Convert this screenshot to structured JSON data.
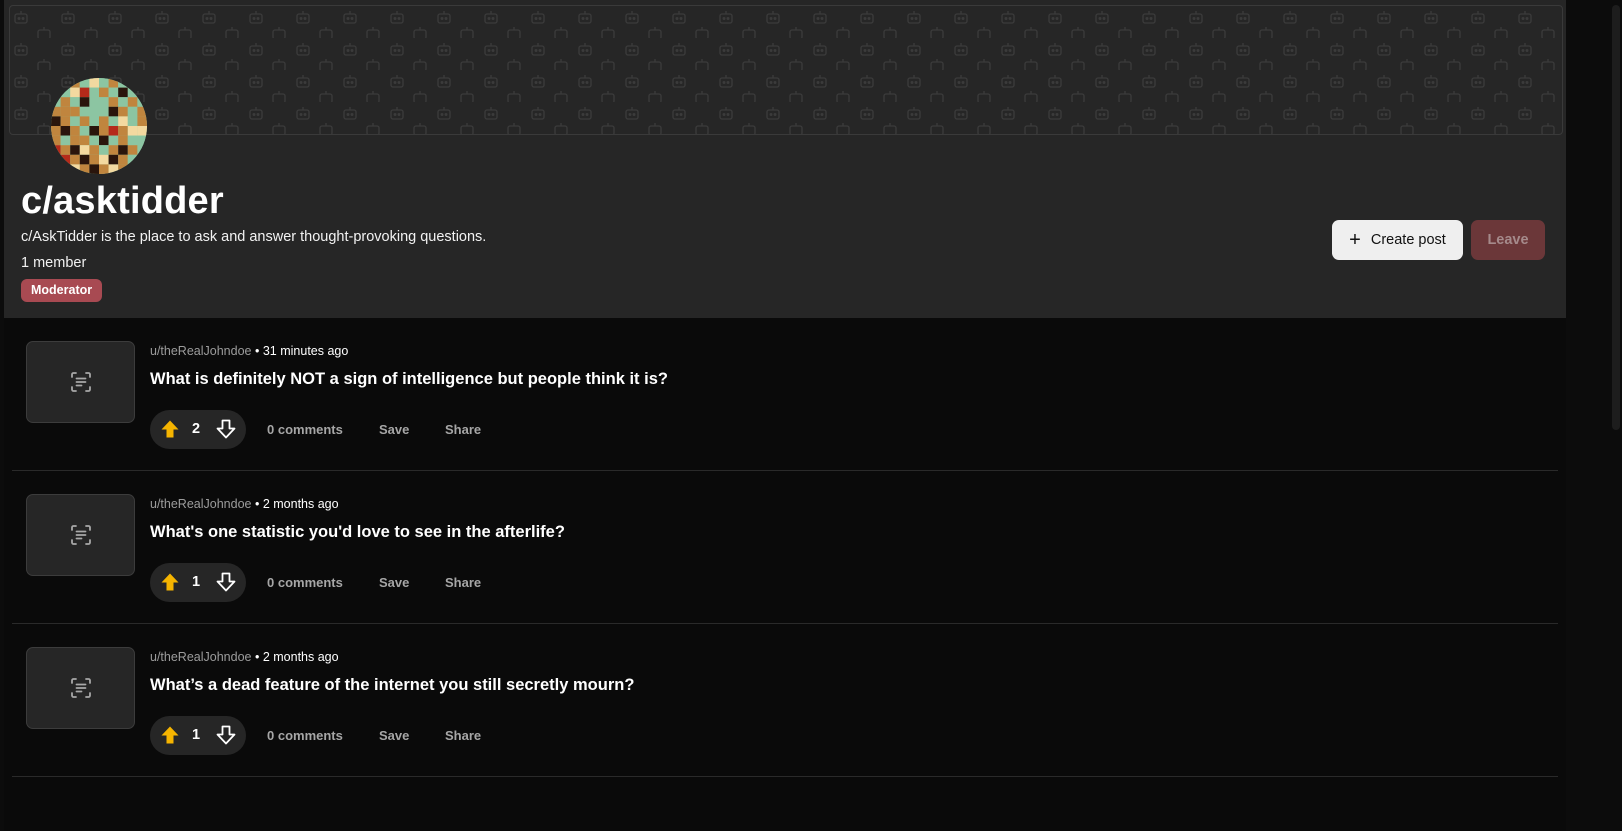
{
  "community": {
    "name": "c/asktidder",
    "description": "c/AskTidder is the place to ask and answer thought-provoking questions.",
    "members": "1 member",
    "role_badge": "Moderator"
  },
  "actions": {
    "create_post": "Create post",
    "leave": "Leave"
  },
  "colors": {
    "header_bg": "#262626",
    "feed_bg": "#0a0a0a",
    "badge": "#a84a52",
    "upvote": "#f5b400",
    "leave_button": "#6b3739"
  },
  "posts": [
    {
      "author": "u/theRealJohndoe",
      "time": "31 minutes ago",
      "title": "What is definitely NOT a sign of intelligence but people think it is?",
      "score": "2",
      "comments": "0 comments",
      "save": "Save",
      "share": "Share"
    },
    {
      "author": "u/theRealJohndoe",
      "time": "2 months ago",
      "title": "What's one statistic you'd love to see in the afterlife?",
      "score": "1",
      "comments": "0 comments",
      "save": "Save",
      "share": "Share"
    },
    {
      "author": "u/theRealJohndoe",
      "time": "2 months ago",
      "title": "What’s a dead feature of the internet you still secretly mourn?",
      "score": "1",
      "comments": "0 comments",
      "save": "Save",
      "share": "Share"
    }
  ]
}
